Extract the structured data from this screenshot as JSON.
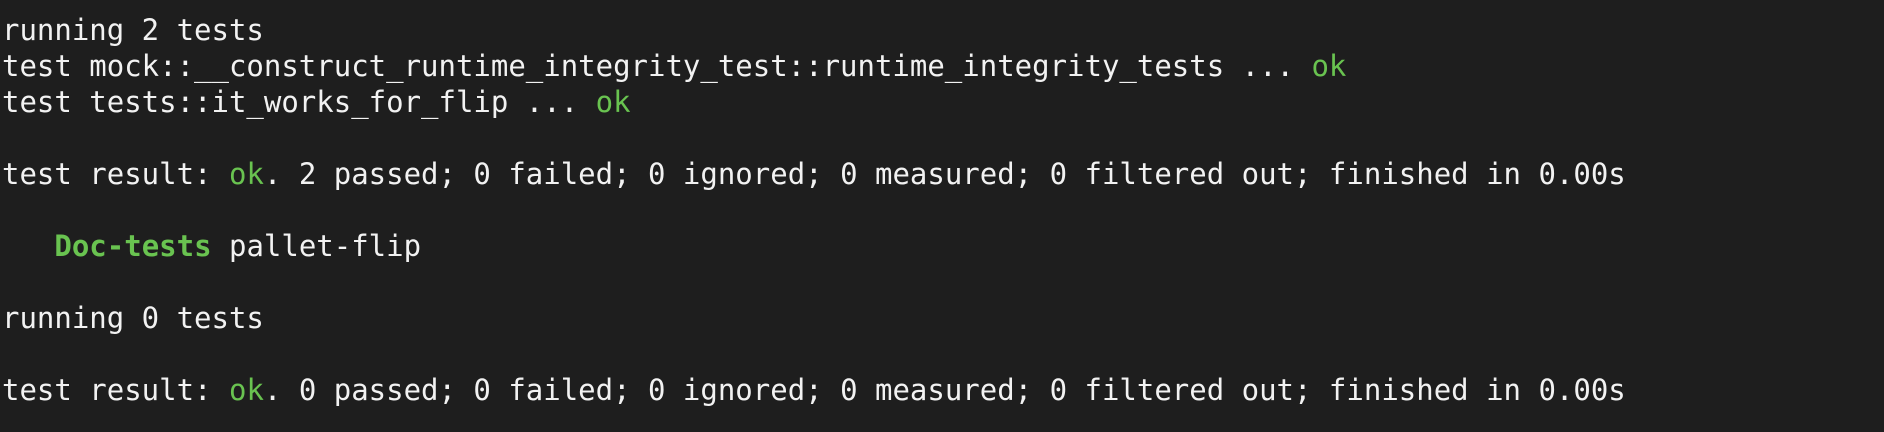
{
  "terminal": {
    "lines": [
      {
        "text": "running 2 tests"
      },
      {
        "prefix": "test mock::__construct_runtime_integrity_test::runtime_integrity_tests ... ",
        "status": "ok"
      },
      {
        "prefix": "test tests::it_works_for_flip ... ",
        "status": "ok"
      },
      {
        "text": ""
      },
      {
        "prefix": "test result: ",
        "status": "ok",
        "suffix": ". 2 passed; 0 failed; 0 ignored; 0 measured; 0 filtered out; finished in 0.00s"
      },
      {
        "text": ""
      },
      {
        "indent": "   ",
        "label": "Doc-tests",
        "suffix": " pallet-flip"
      },
      {
        "text": ""
      },
      {
        "text": "running 0 tests"
      },
      {
        "text": ""
      },
      {
        "prefix": "test result: ",
        "status": "ok",
        "suffix": ". 0 passed; 0 failed; 0 ignored; 0 measured; 0 filtered out; finished in 0.00s"
      }
    ]
  },
  "colors": {
    "background": "#1e1e1e",
    "text": "#f2f2f2",
    "success": "#69c350"
  }
}
